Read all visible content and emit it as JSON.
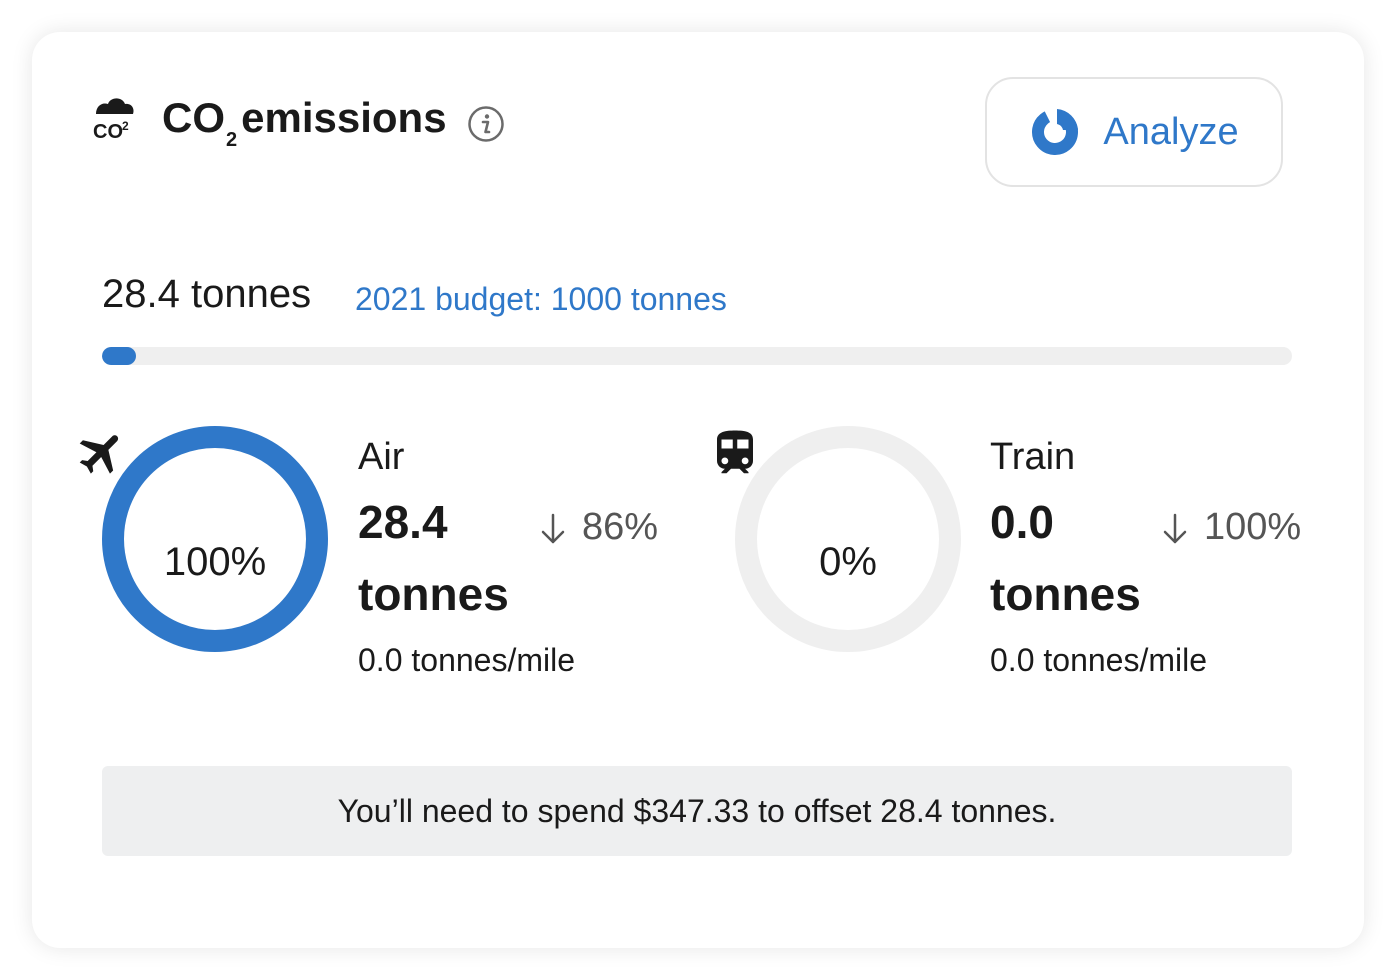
{
  "header": {
    "icon": "co2-cloud-icon",
    "title_prefix": "CO",
    "title_subscript": "2",
    "title_suffix": "emissions",
    "info_icon": "info-icon"
  },
  "analyze_button": {
    "label": "Analyze",
    "icon": "pie-chart-icon",
    "color": "#2f78c9"
  },
  "summary": {
    "total": "28.4 tonnes",
    "budget": "2021 budget: 1000 tonnes",
    "progress_fraction": 0.0284
  },
  "modes": [
    {
      "name": "Air",
      "icon": "airplane-icon",
      "percent_label": "100%",
      "ring_fraction": 1.0,
      "value_line1": "28.4",
      "value_line2": "tonnes",
      "change": "86%",
      "change_icon": "arrow-down-icon",
      "rate": "0.0 tonnes/mile"
    },
    {
      "name": "Train",
      "icon": "train-icon",
      "percent_label": "0%",
      "ring_fraction": 0.0,
      "value_line1": "0.0",
      "value_line2": "tonnes",
      "change": "100%",
      "change_icon": "arrow-down-icon",
      "rate": "0.0 tonnes/mile"
    }
  ],
  "offset_message": "You’ll need to spend $347.33 to offset 28.4 tonnes.",
  "colors": {
    "accent": "#2f78c9",
    "ring_track": "#efefef",
    "offset_bg": "#eeeff0"
  }
}
